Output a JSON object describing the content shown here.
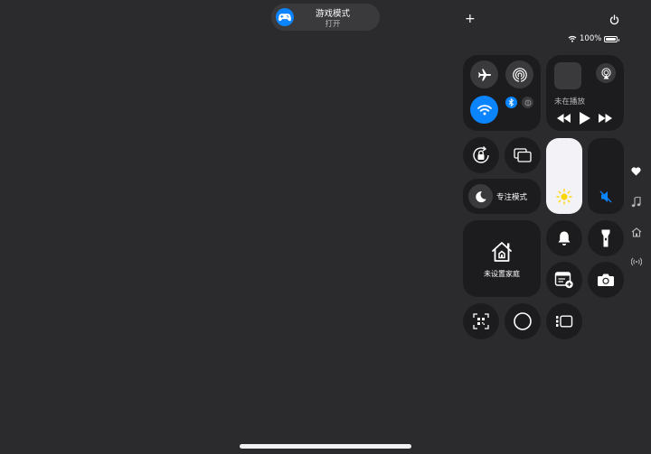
{
  "banner": {
    "title": "游戏模式",
    "subtitle": "打开",
    "icon": "gamecontroller-icon",
    "accent": "#0a84ff"
  },
  "status": {
    "battery": "100%",
    "battery_level": 1.0
  },
  "top": {
    "plus": "+"
  },
  "media": {
    "now_playing": "未在播放"
  },
  "focus": {
    "label": "专注模式"
  },
  "home": {
    "label": "未设置家庭"
  },
  "sliders": {
    "brightness_level": 0.7,
    "volume_level": 0.0,
    "volume_muted": true
  },
  "colors": {
    "wifi_active": "#0a84ff",
    "bluetooth_active": "#0a84ff",
    "background": "#2b2b2d",
    "tile": "#1c1c1e"
  }
}
